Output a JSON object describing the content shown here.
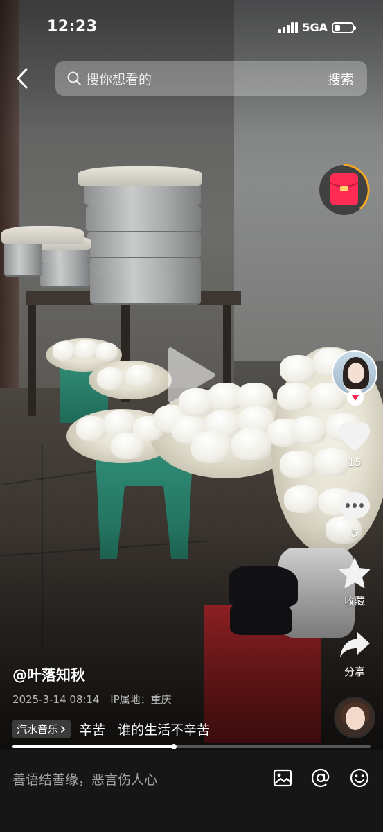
{
  "status_bar": {
    "time": "12:23",
    "network": "5GA",
    "battery_level": 0.35
  },
  "search": {
    "placeholder": "搜你想看的",
    "button_label": "搜索"
  },
  "actions": {
    "like_count": "15",
    "comment_count": "5",
    "favorite_label": "收藏",
    "share_label": "分享"
  },
  "post": {
    "author": "@叶落知秋",
    "date": "2025-3-14 08:14",
    "location": "IP属地：重庆",
    "music_tag": "汽水音乐",
    "caption": "辛苦   谁的生活不辛苦"
  },
  "playback": {
    "progress": 0.45
  },
  "comment_bar": {
    "placeholder": "善语结善缘，恶言伤人心"
  },
  "colors": {
    "accent_red": "#fe2c55",
    "redpacket_ring": "#f5a623"
  },
  "icons": [
    "back-icon",
    "search-icon",
    "redpacket-icon",
    "follow-plus-icon",
    "heart-icon",
    "comment-icon",
    "star-icon",
    "share-icon",
    "image-icon",
    "at-icon",
    "emoji-icon",
    "play-icon"
  ]
}
